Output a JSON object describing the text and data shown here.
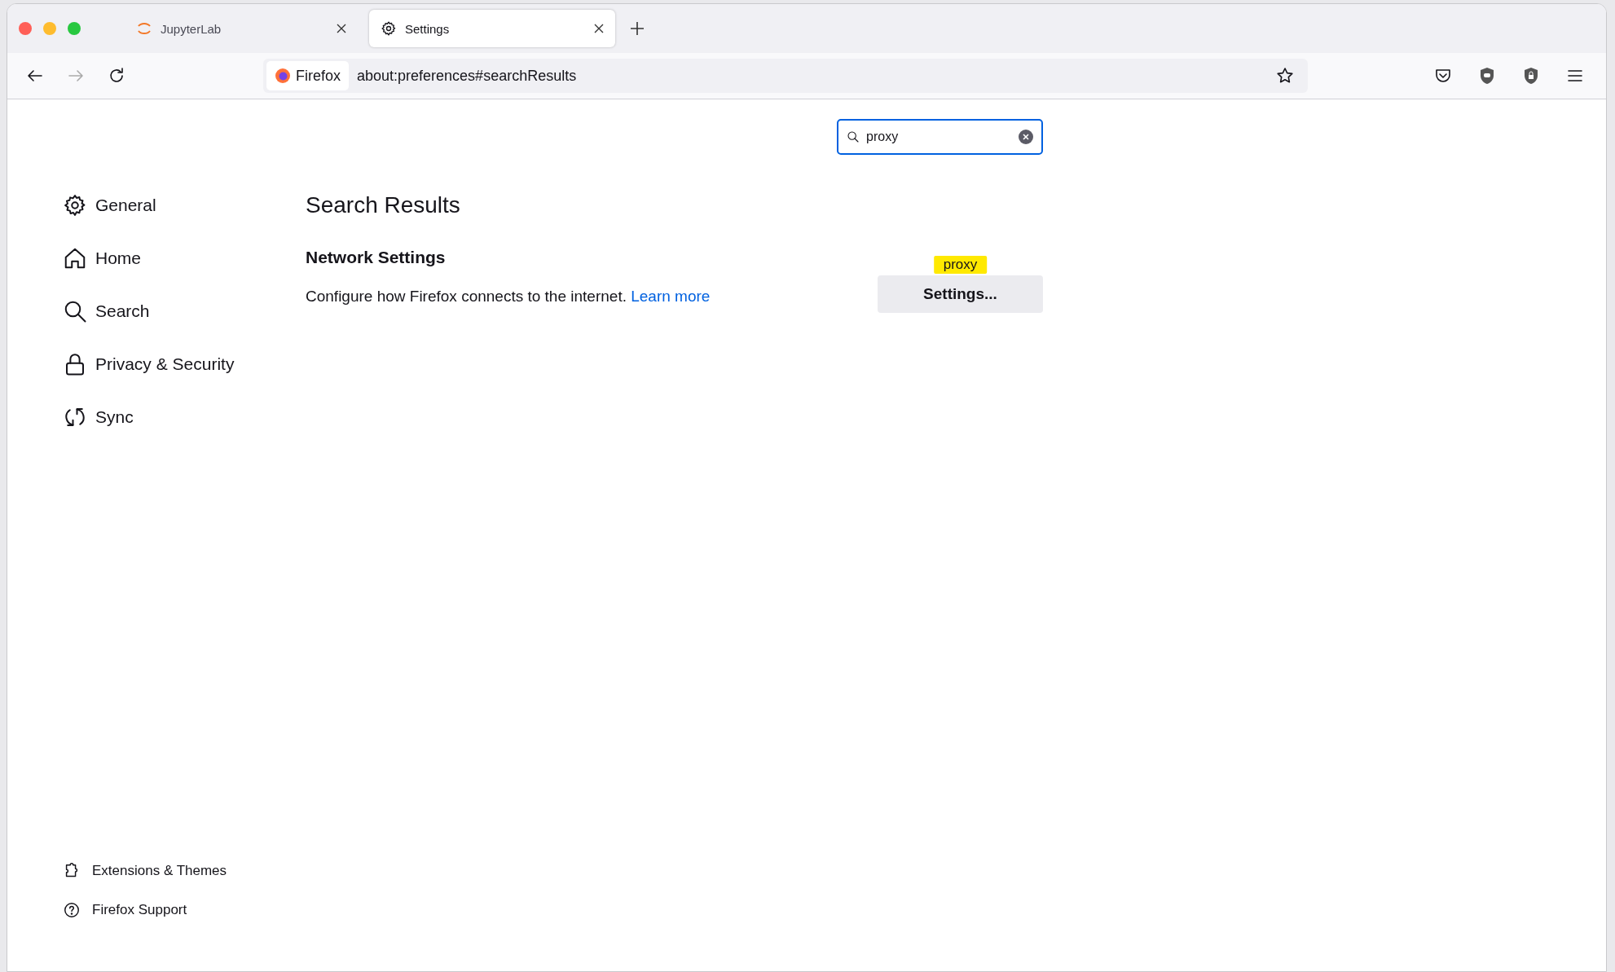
{
  "tabs": [
    {
      "label": "JupyterLab",
      "selected": false
    },
    {
      "label": "Settings",
      "selected": true
    }
  ],
  "address_bar": {
    "identity": "Firefox",
    "url": "about:preferences#searchResults"
  },
  "search": {
    "value": "proxy"
  },
  "sidebar": {
    "items": [
      {
        "label": "General",
        "selected": false
      },
      {
        "label": "Home",
        "selected": false
      },
      {
        "label": "Search",
        "selected": false
      },
      {
        "label": "Privacy & Security",
        "selected": false
      },
      {
        "label": "Sync",
        "selected": false
      }
    ],
    "footer": [
      "Extensions & Themes",
      "Firefox Support"
    ]
  },
  "content": {
    "title": "Search Results",
    "section": "Network Settings",
    "description": "Configure how Firefox connects to the internet.",
    "link": "Learn more",
    "button": "Settings...",
    "highlight": "proxy"
  }
}
